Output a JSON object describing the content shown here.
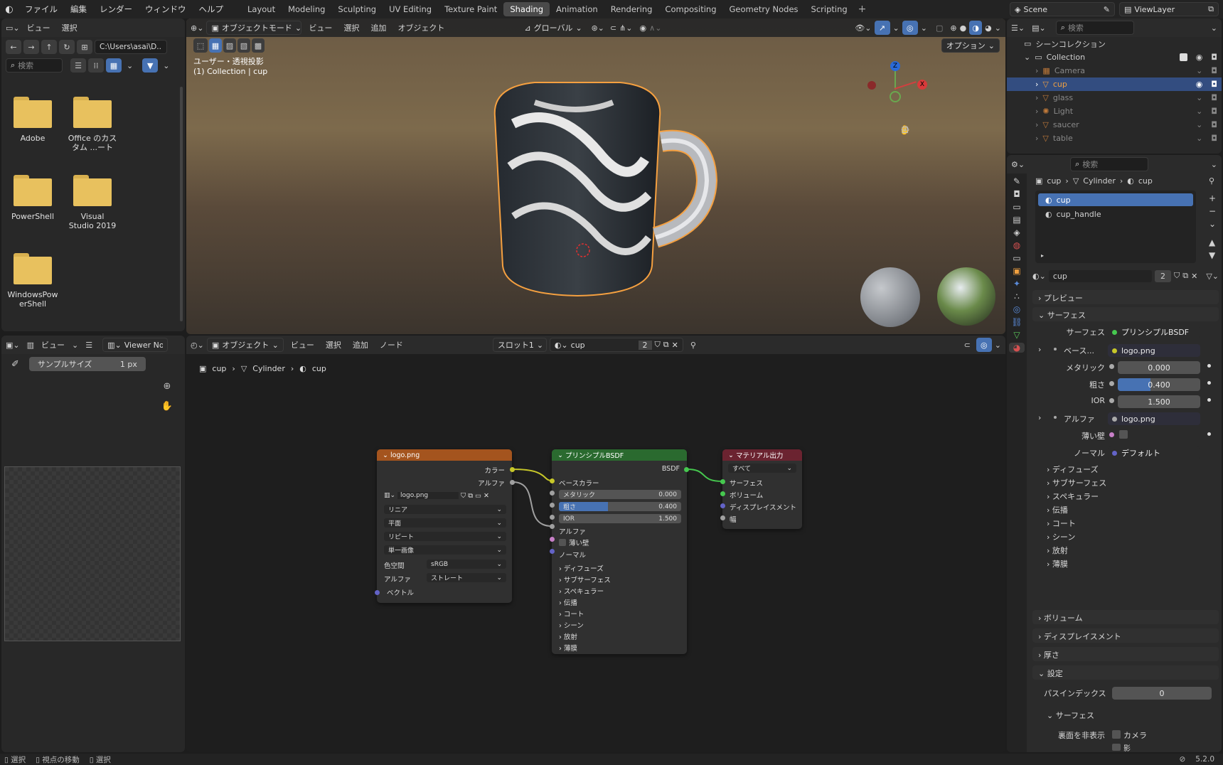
{
  "menu": {
    "blender_icon": "blender-logo-icon",
    "items": [
      "ファイル",
      "編集",
      "レンダー",
      "ウィンドウ",
      "ヘルプ"
    ]
  },
  "workspaces": [
    "Layout",
    "Modeling",
    "Sculpting",
    "UV Editing",
    "Texture Paint",
    "Shading",
    "Animation",
    "Rendering",
    "Compositing",
    "Geometry Nodes",
    "Scripting"
  ],
  "active_workspace": "Shading",
  "scene": {
    "name": "Scene",
    "view_layer": "ViewLayer"
  },
  "filebrowser": {
    "menus": [
      "ビュー",
      "選択"
    ],
    "path": "C:\\Users\\asai\\D...",
    "search_placeholder": "検索",
    "items": [
      {
        "label": "Adobe"
      },
      {
        "label": "Office のカス\nタム ...ート"
      },
      {
        "label": "PowerShell"
      },
      {
        "label": "Visual\nStudio 2019"
      },
      {
        "label": "WindowsPow\nerShell"
      }
    ]
  },
  "viewport": {
    "mode": "オブジェクトモード",
    "menus": [
      "ビュー",
      "選択",
      "追加",
      "オブジェクト"
    ],
    "orientation": "グローバル",
    "options": "オプション",
    "overlay_line1": "ユーザー・透視投影",
    "overlay_line2": "(1) Collection | cup",
    "gizmo": {
      "x": "X",
      "y": "Y",
      "z": "Z"
    }
  },
  "imageeditor": {
    "menus": [
      "ビュー"
    ],
    "viewer": "Viewer Noc",
    "sample_label": "サンプルサイズ",
    "sample_value": "1 px"
  },
  "nodeeditor": {
    "mode": "オブジェクト",
    "menus": [
      "ビュー",
      "選択",
      "追加",
      "ノード"
    ],
    "slot": "スロット1",
    "material": "cup",
    "users": "2",
    "breadcrumb": [
      "cup",
      "Cylinder",
      "cup"
    ],
    "image_node": {
      "title": "logo.png",
      "out_color": "カラー",
      "out_alpha": "アルファ",
      "image": "logo.png",
      "interpolation": "リニア",
      "projection": "平面",
      "extension": "リピート",
      "source": "単一画像",
      "colorspace_label": "色空間",
      "colorspace": "sRGB",
      "alpha_label": "アルファ",
      "alpha_mode": "ストレート",
      "vector": "ベクトル"
    },
    "bsdf_node": {
      "title": "プリンシプルBSDF",
      "out": "BSDF",
      "base_color": "ベースカラー",
      "metallic_label": "メタリック",
      "metallic": "0.000",
      "roughness_label": "粗さ",
      "roughness": "0.400",
      "roughness_fill": 0.4,
      "ior_label": "IOR",
      "ior": "1.500",
      "alpha": "アルファ",
      "thin_film": "薄い壁",
      "normal": "ノーマル",
      "panels": [
        "ディフューズ",
        "サブサーフェス",
        "スペキュラー",
        "伝播",
        "コート",
        "シーン",
        "放射",
        "薄膜"
      ]
    },
    "output_node": {
      "title": "マテリアル出力",
      "target": "すべて",
      "surface": "サーフェス",
      "volume": "ボリューム",
      "displacement": "ディスプレイスメント",
      "thickness": "幅"
    }
  },
  "outliner": {
    "search_placeholder": "検索",
    "root": "シーンコレクション",
    "collection": "Collection",
    "items": [
      {
        "name": "Camera",
        "icon": "camera-icon",
        "selected": false
      },
      {
        "name": "cup",
        "icon": "mesh-icon",
        "selected": true
      },
      {
        "name": "glass",
        "icon": "mesh-icon",
        "selected": false
      },
      {
        "name": "Light",
        "icon": "light-icon",
        "selected": false
      },
      {
        "name": "saucer",
        "icon": "mesh-icon",
        "selected": false
      },
      {
        "name": "table",
        "icon": "mesh-icon",
        "selected": false
      }
    ]
  },
  "properties": {
    "search_placeholder": "検索",
    "breadcrumb": [
      "cup",
      "Cylinder",
      "cup"
    ],
    "slots": [
      "cup",
      "cup_handle"
    ],
    "material": "cup",
    "users": "2",
    "sections": {
      "preview": "プレビュー",
      "surface": "サーフェス",
      "volume": "ボリューム",
      "displacement": "ディスプレイスメント",
      "thickness": "厚さ",
      "settings": "設定"
    },
    "surface_label": "サーフェス",
    "surface_value": "プリンシプルBSDF",
    "base_label": "ベース...",
    "base_value": "logo.png",
    "metallic_label": "メタリック",
    "metallic": "0.000",
    "roughness_label": "粗さ",
    "roughness": "0.400",
    "roughness_fill": 0.4,
    "ior_label": "IOR",
    "ior": "1.500",
    "alpha_label": "アルファ",
    "alpha_value": "logo.png",
    "thin_label": "薄い壁",
    "normal_label": "ノーマル",
    "normal_value": "デフォルト",
    "subpanels": [
      "ディフューズ",
      "サブサーフェス",
      "スペキュラー",
      "伝播",
      "コート",
      "シーン",
      "放射",
      "薄膜"
    ],
    "pass_index_label": "パスインデックス",
    "pass_index": "0",
    "settings_surface": "サーフェス",
    "backface_label": "裏面を非表示",
    "backface_camera": "カメラ",
    "shadow": "影"
  },
  "statusbar": {
    "items": [
      "選択",
      "視点の移動",
      "選択"
    ],
    "version": "5.2.0"
  },
  "colors": {
    "accent": "#4772b3",
    "image_node": "#a4541e",
    "bsdf_node": "#2a6a2f",
    "output_node": "#6b2330",
    "selection": "#f0a040"
  }
}
